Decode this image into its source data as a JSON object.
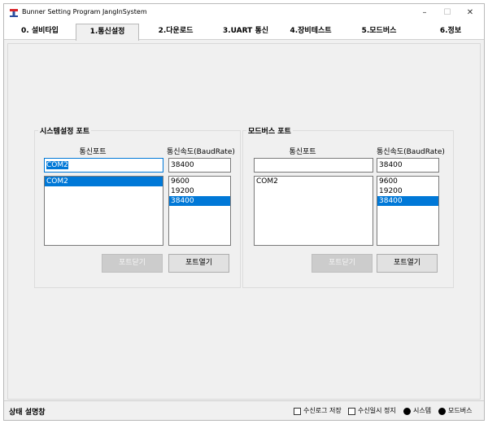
{
  "window": {
    "title": "Bunner Setting Program JangInSystem",
    "controls": {
      "minimize": "–",
      "maximize": "☐",
      "close": "✕"
    }
  },
  "tabs": [
    {
      "label": "0. 설비타입",
      "active": false
    },
    {
      "label": "1.통신설정",
      "active": true
    },
    {
      "label": "2.다운로드",
      "active": false
    },
    {
      "label": "3.UART 통신",
      "active": false
    },
    {
      "label": "4.장비테스트",
      "active": false
    },
    {
      "label": "5.모드버스",
      "active": false
    },
    {
      "label": "6.정보",
      "active": false
    }
  ],
  "system_port": {
    "group_title": "시스템설정 포트",
    "port_label": "통신포트",
    "baud_label": "통신속도(BaudRate)",
    "port_input": "COM2",
    "baud_input": "38400",
    "port_list": [
      "COM2"
    ],
    "port_selected": 0,
    "baud_list": [
      "9600",
      "19200",
      "38400"
    ],
    "baud_selected": 2,
    "close_button": "포트닫기",
    "open_button": "포트열기"
  },
  "modbus_port": {
    "group_title": "모드버스 포트",
    "port_label": "통신포트",
    "baud_label": "통신속도(BaudRate)",
    "port_input": "",
    "baud_input": "38400",
    "port_list": [
      "COM2"
    ],
    "baud_list": [
      "9600",
      "19200",
      "38400"
    ],
    "baud_selected": 2,
    "close_button": "포트닫기",
    "open_button": "포트열기"
  },
  "statusbar": {
    "status_text": "상태 설명창",
    "log_save_label": "수신로그 저장",
    "pause_label": "수신일시 정지",
    "system_led_label": "시스템",
    "modbus_led_label": "모드버스"
  },
  "colors": {
    "accent": "#0078d7",
    "background": "#f0f0f0"
  }
}
